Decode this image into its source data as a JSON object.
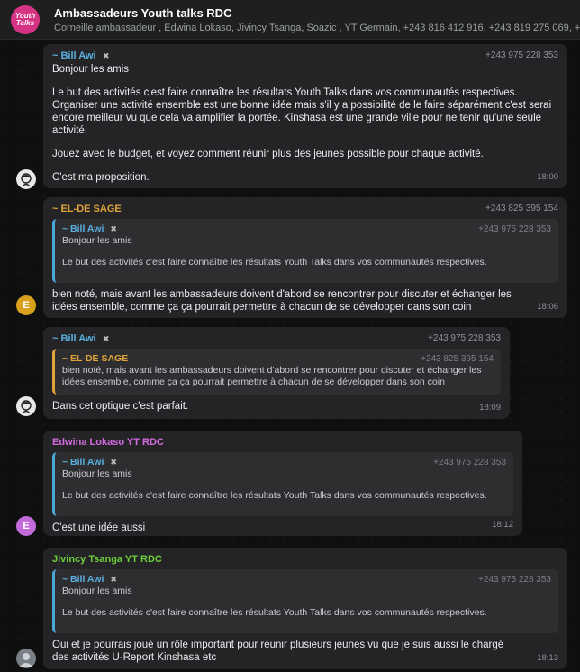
{
  "header": {
    "avatar_text": "Youth Talks",
    "title": "Ambassadeurs Youth talks RDC",
    "members": "Corneille ambassadeur , Edwina Lokaso, Jivincy Tsanga, Soazic , YT Germain, +243 816 412 916, +243 819 275 069, +243 8"
  },
  "messages": {
    "m1": {
      "sender": "~ Bill Awi",
      "badge": "✖",
      "phone": "+243 975 228 353",
      "p1": "Bonjour les amis",
      "p2": "Le but des activités c'est faire connaître les résultats Youth Talks dans vos communautés respectives. Organiser une activité ensemble est une bonne idée mais s'il y a  possibilité de le faire séparément c'est serai encore meilleur vu que cela va amplifier la portée. Kinshasa est une grande ville pour ne tenir qu'une seule activité.",
      "p3": "Jouez avec le budget, et voyez comment réunir plus des jeunes possible pour chaque activité.",
      "p4": "C'est ma proposition.",
      "time": "18:00"
    },
    "m2": {
      "sender": "~ EL-DE SAGE",
      "phone": "+243 825 395 154",
      "quote_name": "~ Bill Awi",
      "quote_badge": "✖",
      "quote_phone": "+243 975 228 353",
      "quote_p1": "Bonjour les amis",
      "quote_p2": "Le but des activités c'est faire connaître les résultats Youth Talks dans vos communautés respectives.",
      "text": "bien noté, mais avant les ambassadeurs doivent d'abord se rencontrer pour discuter et échanger les idées ensemble, comme ça ça pourrait permettre à chacun de se développer dans son coin",
      "time": "18:06",
      "avatar_letter": "E"
    },
    "m3": {
      "sender": "~ Bill Awi",
      "badge": "✖",
      "phone": "+243 975 228 353",
      "quote_name": "~ EL-DE SAGE",
      "quote_phone": "+243 825 395 154",
      "quote_text": "bien noté, mais avant les ambassadeurs doivent d'abord se rencontrer pour discuter et échanger les idées ensemble, comme ça ça pourrait permettre à chacun de se développer dans son coin",
      "text": "Dans cet optique c'est parfait.",
      "time": "18:09"
    },
    "m4": {
      "sender": "Edwina Lokaso YT RDC",
      "quote_name": "~ Bill Awi",
      "quote_badge": "✖",
      "quote_phone": "+243 975 228 353",
      "quote_p1": "Bonjour les amis",
      "quote_p2": "Le but des activités c'est faire connaître les résultats Youth Talks dans vos communautés respectives.",
      "text": "C'est une idée aussi",
      "time": "18:12",
      "avatar_letter": "E"
    },
    "m5": {
      "sender": "Jivincy Tsanga YT RDC",
      "quote_name": "~ Bill Awi",
      "quote_badge": "✖",
      "quote_phone": "+243 975 228 353",
      "quote_p1": "Bonjour les amis",
      "quote_p2": "Le but des activités c'est faire connaître les résultats Youth Talks dans vos communautés respectives.",
      "text": "Oui et je pourrais joué un rôle important pour réunir plusieurs jeunes vu que je suis aussi le chargé des activités U-Report Kinshasa etc",
      "time": "18:13"
    }
  },
  "colors": {
    "bill": "#5ab0e0",
    "elde": "#e0a43a",
    "edwina": "#d46be0",
    "jivincy": "#6fcf3a",
    "elde_avatar": "#d9a01c",
    "edwina_avatar": "#c46bdc"
  }
}
